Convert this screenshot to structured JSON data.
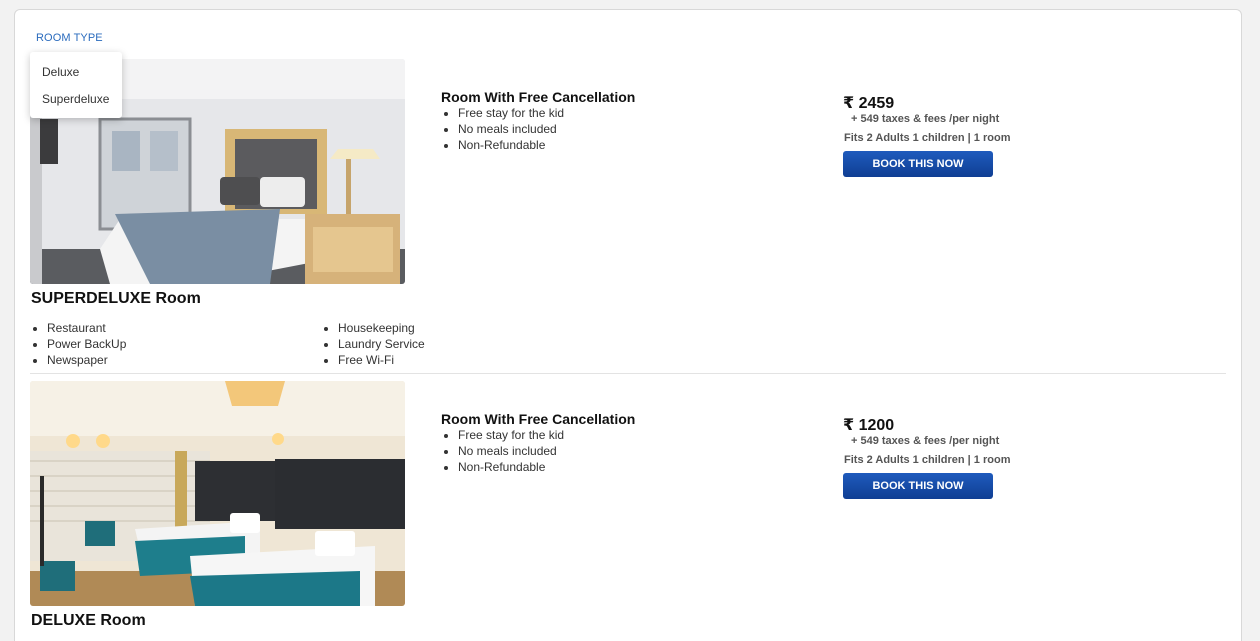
{
  "filter": {
    "label": "ROOM TYPE",
    "options": [
      "Deluxe",
      "Superdeluxe"
    ]
  },
  "currency_symbol": "₹",
  "rooms": [
    {
      "name": "SUPERDELUXE Room",
      "offer_title": "Room With Free Cancellation",
      "offer_features": [
        "Free stay for the kid",
        "No meals included",
        "Non-Refundable"
      ],
      "price": "2459",
      "taxes": "+ 549 taxes & fees /per night",
      "fits": "Fits 2 Adults 1 children | 1 room",
      "button": "BOOK THIS NOW",
      "amenities_left": [
        "Restaurant",
        "Power BackUp",
        "Newspaper"
      ],
      "amenities_right": [
        "Housekeeping",
        "Laundry Service",
        "Free Wi-Fi"
      ]
    },
    {
      "name": "DELUXE Room",
      "offer_title": "Room With Free Cancellation",
      "offer_features": [
        "Free stay for the kid",
        "No meals included",
        "Non-Refundable"
      ],
      "price": "1200",
      "taxes": "+ 549 taxes & fees /per night",
      "fits": "Fits 2 Adults 1 children | 1 room",
      "button": "BOOK THIS NOW"
    }
  ]
}
